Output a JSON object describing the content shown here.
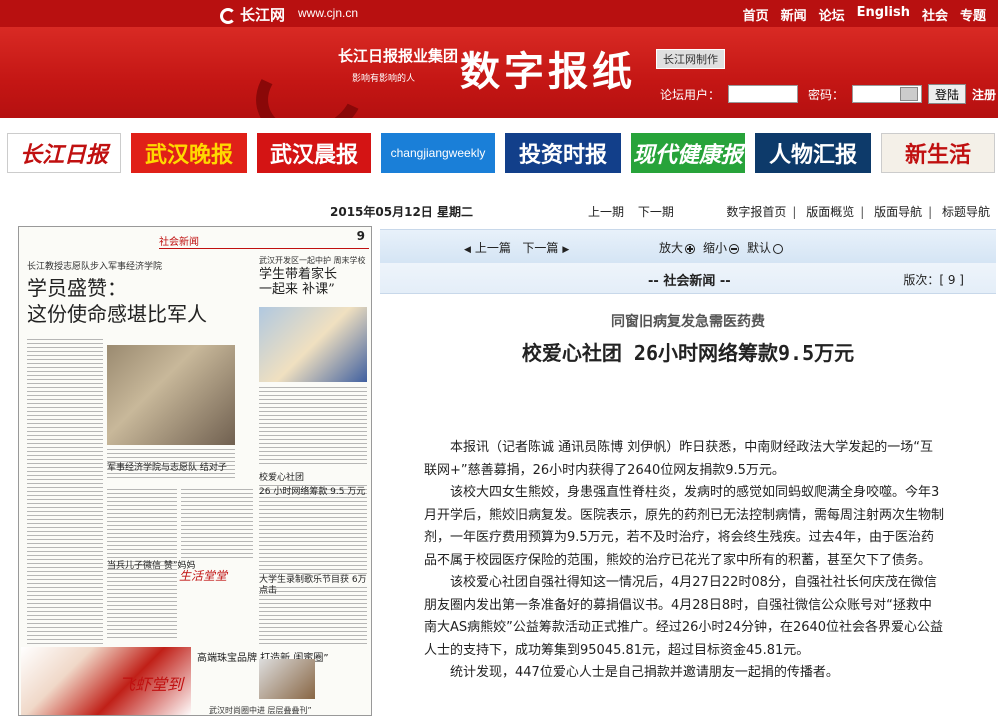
{
  "topbar": {
    "logo": "长江网",
    "url": "www.cjn.cn",
    "nav": [
      "首页",
      "新闻",
      "论坛",
      "English",
      "社会",
      "专题"
    ]
  },
  "banner": {
    "group_name": "长江日报报业集团",
    "slogan": "影响有影响的人",
    "title": "数字报纸",
    "maker": "长江网制作",
    "login": {
      "user_label": "论坛用户：",
      "pwd_label": "密码：",
      "login_button": "登陆",
      "register": "注册"
    }
  },
  "papers": [
    "长江日报",
    "武汉晚报",
    "武汉晨报",
    "changjiangweekly",
    "投资时报",
    "现代健康报",
    "人物汇报",
    "新生活"
  ],
  "dateline": {
    "date": "2015年05月12日  星期二",
    "prev_issue": "上一期",
    "next_issue": "下一期"
  },
  "sitenav": [
    "数字报首页",
    "版面概览",
    "版面导航",
    "标题导航"
  ],
  "thumbnail": {
    "section": "社会新闻",
    "page_no": "9",
    "left_kicker": "长江教授志愿队步入军事经济学院",
    "left_headline_1": "学员盛赞：",
    "left_headline_2": "这份使命感堪比军人",
    "right_kicker": "武汉开发区一起中护 周末学校",
    "right_headline_1": "学生带着家长",
    "right_headline_2": "一起来 补课”",
    "sub1": "军事经济学院与志愿队 结对子",
    "sub2": "校爱心社团",
    "sub3": "26 小时网络筹款 9.5 万元",
    "sub4": "当兵儿子微信 赞”妈妈",
    "sub5": "大学生录制歌乐节目获 6万点击",
    "brand": "生活堂堂",
    "ad_text": "飞虾堂到",
    "ad2": "高端珠宝品牌  打造新  闺蜜圈”",
    "footer": "武汉时尚圈中进  层层叠叠刊”"
  },
  "article": {
    "prev": "上一篇",
    "next": "下一篇",
    "zoom_in": "放大",
    "zoom_out": "缩小",
    "default": "默认",
    "section": "-- 社会新闻 --",
    "version": "版次：[ 9 ]",
    "kicker": "同窗旧病复发急需医药费",
    "headline": "校爱心社团 26小时网络筹款9.5万元",
    "paragraphs": [
      "本报讯（记者陈诚 通讯员陈博 刘伊帆）昨日获悉，中南财经政法大学发起的一场“互联网+”慈善募捐，26小时内获得了2640位网友捐款9.5万元。",
      "该校大四女生熊姣，身患强直性脊柱炎，发病时的感觉如同蚂蚁爬满全身咬噬。今年3月开学后，熊姣旧病复发。医院表示，原先的药剂已无法控制病情，需每周注射两次生物制剂，一年医疗费用预算为9.5万元，若不及时治疗，将会终生残疾。过去4年，由于医治药品不属于校园医疗保险的范围，熊姣的治疗已花光了家中所有的积蓄，甚至欠下了债务。",
      "该校爱心社团自强社得知这一情况后，4月27日22时08分，自强社社长何庆茂在微信朋友圈内发出第一条准备好的募捐倡议书。4月28日8时，自强社微信公众账号对“拯救中南大AS病熊姣”公益筹款活动正式推广。经过26小时24分钟，在2640位社会各界爱心公益人士的支持下，成功筹集到95045.81元，超过目标资金45.81元。",
      "统计发现，447位爱心人士是自己捐款并邀请朋友一起捐的传播者。"
    ]
  }
}
